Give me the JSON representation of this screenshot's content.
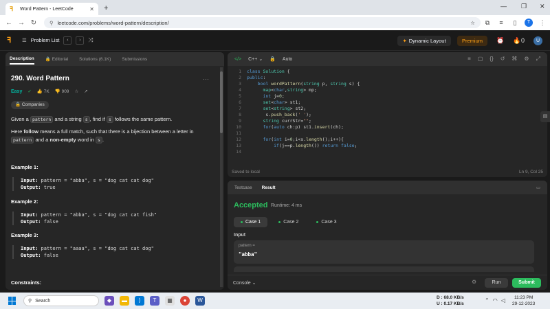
{
  "browser": {
    "tab_title": "Word Pattern - LeetCode",
    "url": "leetcode.com/problems/word-pattern/description/",
    "profile_initial": "T"
  },
  "header": {
    "problem_list": "Problem List",
    "dynamic_layout": "Dynamic Layout",
    "premium": "Premium",
    "streak": "0",
    "avatar_initial": "U"
  },
  "left_tabs": [
    "Description",
    "Editorial",
    "Solutions (6.1K)",
    "Submissions"
  ],
  "problem": {
    "title": "290. Word Pattern",
    "difficulty": "Easy",
    "likes": "7K",
    "dislikes": "909",
    "companies": "Companies",
    "desc1_a": "Given a ",
    "desc1_code1": "pattern",
    "desc1_b": " and a string ",
    "desc1_code2": "s",
    "desc1_c": ", find if ",
    "desc1_code3": "s",
    "desc1_d": " follows the same pattern.",
    "desc2_a": "Here ",
    "desc2_follow": "follow",
    "desc2_b": " means a full match, such that there is a bijection between a letter in",
    "desc2_code1": "pattern",
    "desc2_c": " and a ",
    "desc2_nonempty": "non-empty",
    "desc2_d": " word in ",
    "desc2_code2": "s",
    "desc2_e": ".",
    "examples": [
      {
        "title": "Example 1:",
        "input": "pattern = \"abba\", s = \"dog cat cat dog\"",
        "output": "true"
      },
      {
        "title": "Example 2:",
        "input": "pattern = \"abba\", s = \"dog cat cat fish\"",
        "output": "false"
      },
      {
        "title": "Example 3:",
        "input": "pattern = \"aaaa\", s = \"dog cat cat dog\"",
        "output": "false"
      }
    ],
    "input_label": "Input:",
    "output_label": "Output:",
    "constraints": "Constraints:"
  },
  "editor": {
    "language": "C++",
    "mode": "Auto",
    "saved": "Saved to local",
    "cursor": "Ln 9, Col 25",
    "lines": [
      "1",
      "2",
      "3",
      "4",
      "5",
      "6",
      "7",
      "8",
      "9",
      "10",
      "11",
      "12",
      "13",
      "14"
    ]
  },
  "result": {
    "tabs": [
      "Testcase",
      "Result"
    ],
    "status": "Accepted",
    "runtime": "Runtime: 4 ms",
    "cases": [
      "Case 1",
      "Case 2",
      "Case 3"
    ],
    "input_label": "Input",
    "param_name": "pattern =",
    "param_value": "\"abba\"",
    "console": "Console",
    "run": "Run",
    "submit": "Submit"
  },
  "taskbar": {
    "search": "Search",
    "net_down": "D : 68.0 KB/s",
    "net_up": "U : 0.17 KB/s",
    "time": "11:23 PM",
    "date": "29-12-2023"
  }
}
